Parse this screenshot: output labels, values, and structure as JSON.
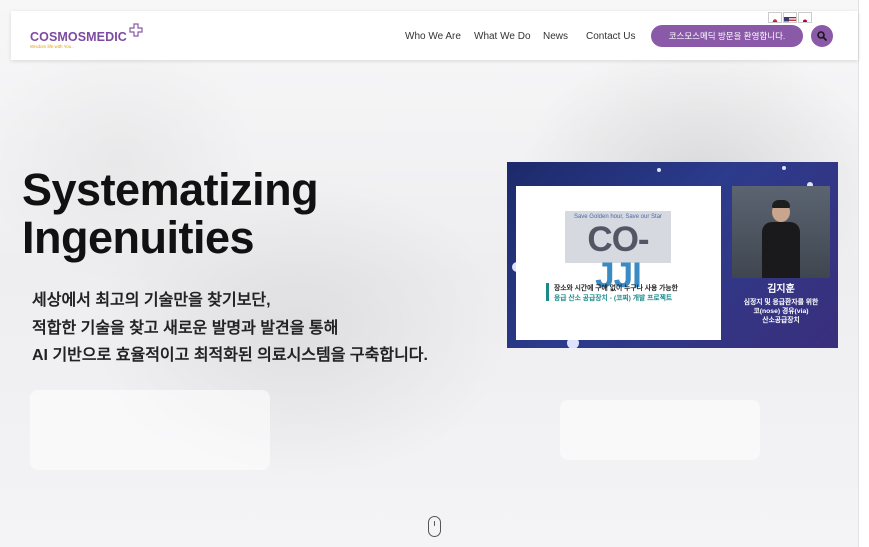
{
  "header": {
    "logo": {
      "text": "COSMOSMEDIC",
      "tagline": "Wisdom life with You.."
    },
    "nav": [
      {
        "label": "Who We Are"
      },
      {
        "label": "What We Do"
      },
      {
        "label": "News"
      },
      {
        "label": "Contact Us"
      }
    ],
    "welcome_button": "코스모스메딕 방문을 환영합니다.",
    "languages": [
      {
        "name": "korea-flag-icon"
      },
      {
        "name": "usa-flag-icon"
      },
      {
        "name": "japan-flag-icon"
      }
    ]
  },
  "hero": {
    "title_line1": "Systematizing",
    "title_line2": "Ingenuities",
    "subtitle": [
      "세상에서 최고의 기술만을 찾기보단,",
      "적합한 기술을 찾고 새로운 발명과 발견을 통해",
      "AI 기반으로 효율적이고 최적화된 의료시스템을 구축합니다."
    ]
  },
  "video": {
    "slide_tagline": "Save Golden hour, Save our Star",
    "slide_logo_a": "CO-",
    "slide_logo_b": "JJI",
    "slide_line1": "장소와 시간에 구애 없이 누구나 사용 가능한",
    "slide_line2": "응급 산소 공급장치 - (코찌) 개발 프로젝트",
    "speaker_name": "김지훈",
    "caption": [
      "심정지 및 응급환자를 위한",
      "코(nose) 경유(via)",
      "산소공급장치"
    ]
  },
  "colors": {
    "brand_purple": "#8a5aa8",
    "logo_purple": "#7d4aa3",
    "accent_gold": "#e0a21d"
  }
}
